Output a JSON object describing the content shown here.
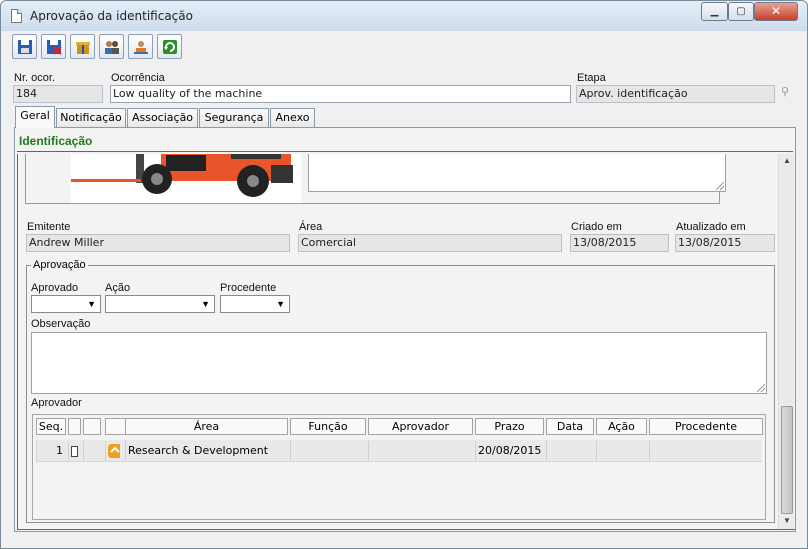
{
  "window": {
    "title": "Aprovação da identificação"
  },
  "header": {
    "nr_label": "Nr. ocor.",
    "nr_value": "184",
    "ocorrencia_label": "Ocorrência",
    "ocorrencia_value": "Low quality of the machine",
    "etapa_label": "Etapa",
    "etapa_value": "Aprov. identificação"
  },
  "tabs": [
    "Geral",
    "Notificação",
    "Associação",
    "Segurança",
    "Anexo"
  ],
  "section": {
    "title": "Identificação"
  },
  "info": {
    "emitente_label": "Emitente",
    "emitente_value": "Andrew Miller",
    "area_label": "Área",
    "area_value": "Comercial",
    "criado_label": "Criado em",
    "criado_value": "13/08/2015",
    "atualizado_label": "Atualizado em",
    "atualizado_value": "13/08/2015"
  },
  "approval": {
    "legend": "Aprovação",
    "aprovado_label": "Aprovado",
    "acao_label": "Ação",
    "procedente_label": "Procedente",
    "observacao_label": "Observação",
    "aprovador_label": "Aprovador"
  },
  "grid": {
    "headers": [
      "Seq.",
      "",
      "",
      "Área",
      "Função",
      "Aprovador",
      "Prazo",
      "Data",
      "Ação",
      "Procedente"
    ],
    "rows": [
      {
        "seq": "1",
        "area": "Research & Development",
        "funcao": "",
        "aprovador": "",
        "prazo": "20/08/2015",
        "data": "",
        "acao": "",
        "procedente": ""
      }
    ]
  },
  "colors": {
    "accent_green": "#1f7a1f",
    "image_orange": "#e8552b"
  }
}
